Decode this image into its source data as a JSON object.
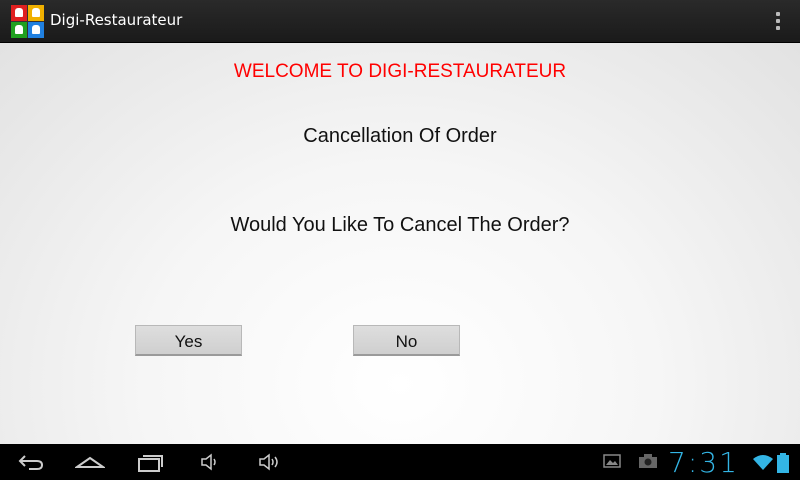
{
  "app": {
    "title": "Digi-Restaurateur",
    "icon": "app-logo-icon",
    "icon_colors": [
      "#e02020",
      "#f0b000",
      "#20a020",
      "#2080e0"
    ]
  },
  "actionbar": {
    "overflow_icon": "overflow-menu-icon"
  },
  "main": {
    "welcome": "WELCOME TO DIGI-RESTAURATEUR",
    "heading": "Cancellation Of Order",
    "question": "Would You Like To Cancel The Order?",
    "yes_label": "Yes",
    "no_label": "No"
  },
  "colors": {
    "welcome": "#ff0000",
    "clock": "#33b5e5"
  },
  "system_bar": {
    "icons": [
      "back-icon",
      "home-icon",
      "recent-apps-icon",
      "volume-down-icon",
      "volume-up-icon",
      "gallery-icon",
      "camera-icon",
      "wifi-icon",
      "battery-icon"
    ],
    "clock": "7:31"
  }
}
